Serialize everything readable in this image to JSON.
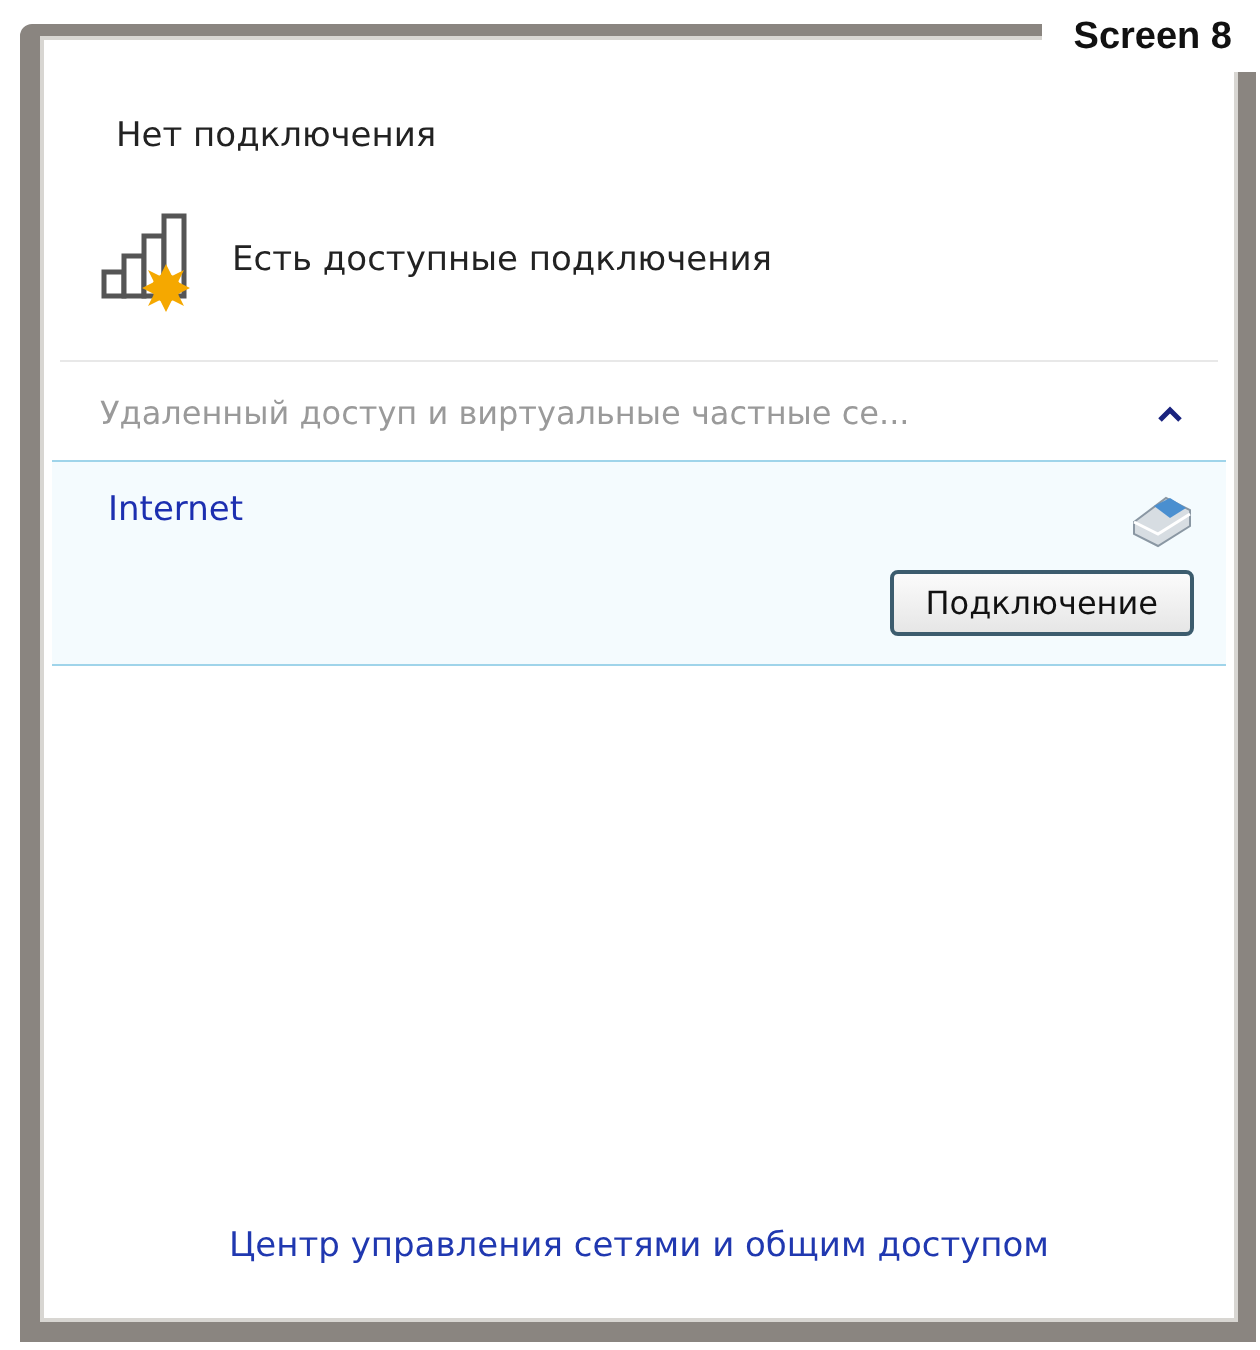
{
  "caption": "Screen 8",
  "status": {
    "title": "Нет подключения",
    "available": "Есть доступные подключения"
  },
  "section": {
    "title": "Удаленный доступ и виртуальные частные се...",
    "expanded": true
  },
  "connections": [
    {
      "name": "Internet",
      "selected": true,
      "button": "Подключение"
    }
  ],
  "footer_link": "Центр управления сетями и общим доступом"
}
